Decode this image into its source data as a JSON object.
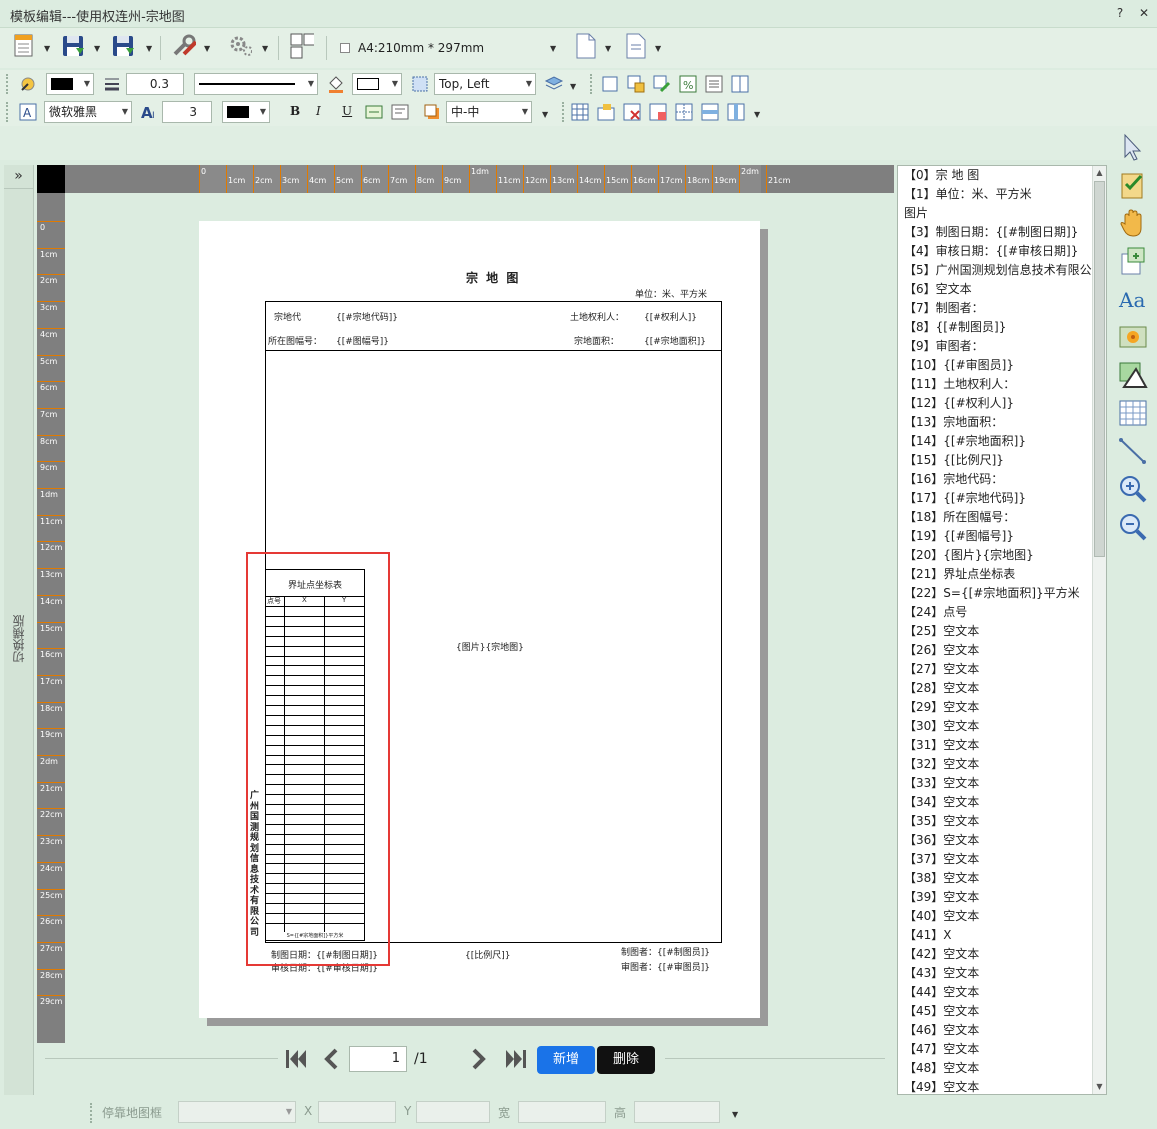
{
  "window": {
    "title": "模板编辑---使用权连州-宗地图",
    "help": "?",
    "close": "✕"
  },
  "toolbar1": {
    "paper_size": "A4:210mm * 297mm"
  },
  "toolbar2": {
    "line_width": "0.3",
    "anchor": "Top, Left"
  },
  "toolbar3": {
    "font_name": "微软雅黑",
    "font_size": "3",
    "bold": "B",
    "italic": "I",
    "underline": "U",
    "align": "中-中"
  },
  "left_strip": {
    "expand": "»",
    "label": "切换横版"
  },
  "ruler": {
    "top_labels": [
      "0",
      "1cm",
      "2cm",
      "3cm",
      "4cm",
      "5cm",
      "6cm",
      "7cm",
      "8cm",
      "9cm",
      "1dm",
      "11cm",
      "12cm",
      "13cm",
      "14cm",
      "15cm",
      "16cm",
      "17cm",
      "18cm",
      "19cm",
      "2dm",
      "21cm"
    ],
    "left_labels": [
      "0",
      "1cm",
      "2cm",
      "3cm",
      "4cm",
      "5cm",
      "6cm",
      "7cm",
      "8cm",
      "9cm",
      "1dm",
      "11cm",
      "12cm",
      "13cm",
      "14cm",
      "15cm",
      "16cm",
      "17cm",
      "18cm",
      "19cm",
      "2dm",
      "21cm",
      "22cm",
      "23cm",
      "24cm",
      "25cm",
      "26cm",
      "27cm",
      "28cm",
      "29cm"
    ]
  },
  "paper": {
    "title": "宗 地 图",
    "unit": "单位：米、平方米",
    "parcel_code_label": "宗地代",
    "parcel_code_value": "{[#宗地代码]}",
    "owner_label": "土地权利人：",
    "owner_value": "{[#权利人]}",
    "sheet_label": "所在图幅号：",
    "sheet_value": "{[#图幅号]}",
    "area_label": "宗地面积：",
    "area_value": "{[#宗地面积]}",
    "picture": "{图片}{宗地图}",
    "coord_table_title": "界址点坐标表",
    "coord_headers": [
      "点号",
      "X",
      "Y"
    ],
    "coord_footer": "S={[#宗地面积]}平方米",
    "company_vertical": "广州国测规划信息技术有限公司",
    "draw_date": "制图日期：{[#制图日期]}",
    "check_date": "审核日期：{[#审核日期]}",
    "scale": "{[比例尺]}",
    "drawer": "制图者：{[#制图员]}",
    "checker": "审图者：{[#审图员]}"
  },
  "items": [
    "【0】宗 地 图",
    "【1】单位：米、平方米",
    "图片",
    "【3】制图日期：{[#制图日期]}",
    "【4】审核日期：{[#审核日期]}",
    "【5】广州国测规划信息技术有限公",
    "【6】空文本",
    "【7】制图者：",
    "【8】{[#制图员]}",
    "【9】审图者：",
    "【10】{[#审图员]}",
    "【11】土地权利人：",
    "【12】{[#权利人]}",
    "【13】宗地面积：",
    "【14】{[#宗地面积]}",
    "【15】{[比例尺]}",
    "【16】宗地代码：",
    "【17】{[#宗地代码]}",
    "【18】所在图幅号：",
    "【19】{[#图幅号]}",
    "【20】{图片}{宗地图}",
    "【21】界址点坐标表",
    "【22】S={[#宗地面积]}平方米",
    "【24】点号",
    "【25】空文本",
    "【26】空文本",
    "【27】空文本",
    "【28】空文本",
    "【29】空文本",
    "【30】空文本",
    "【31】空文本",
    "【32】空文本",
    "【33】空文本",
    "【34】空文本",
    "【35】空文本",
    "【36】空文本",
    "【37】空文本",
    "【38】空文本",
    "【39】空文本",
    "【40】空文本",
    "【41】X",
    "【42】空文本",
    "【43】空文本",
    "【44】空文本",
    "【45】空文本",
    "【46】空文本",
    "【47】空文本",
    "【48】空文本",
    "【49】空文本"
  ],
  "pager": {
    "current": "1",
    "total": "/1",
    "add": "新增",
    "delete": "删除"
  },
  "bottom": {
    "dock_label": "停靠地图框",
    "x_label": "X",
    "y_label": "Y",
    "w_label": "宽",
    "h_label": "高"
  },
  "colors": {
    "accent": "#1a73e8",
    "highlight": "#e53935",
    "ruler_bg": "#7f7f7f",
    "ruler_tick": "#e07a00"
  }
}
